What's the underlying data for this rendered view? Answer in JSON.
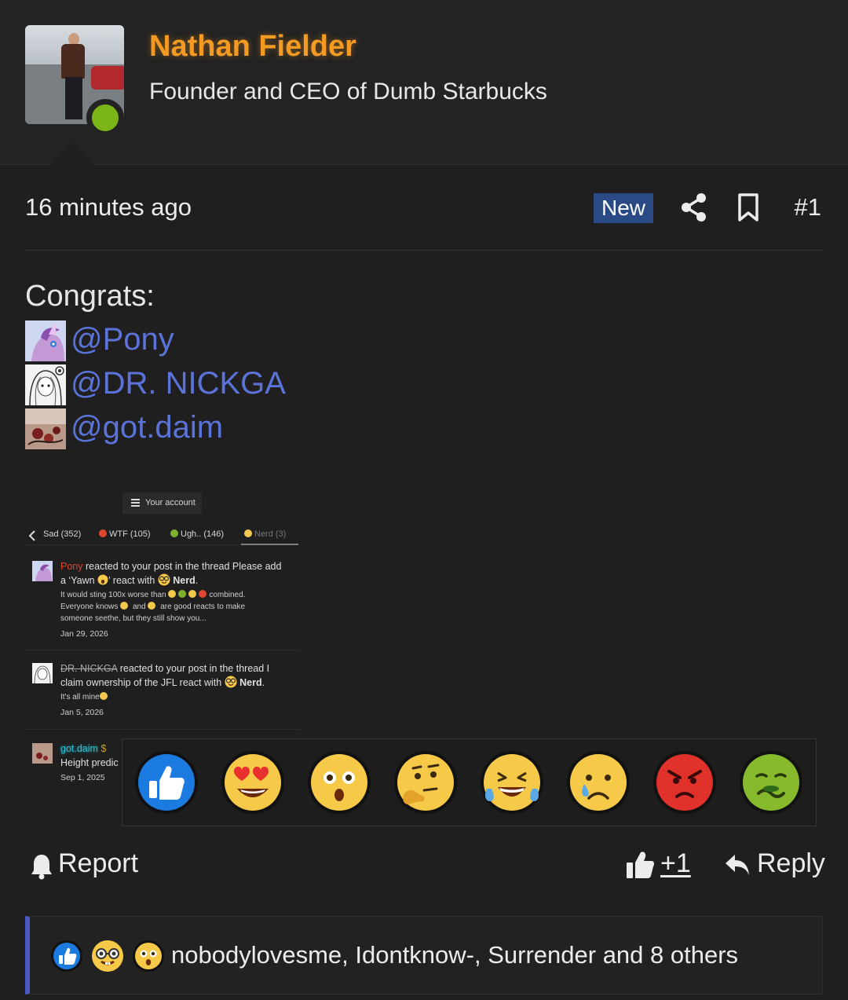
{
  "colors": {
    "username": "#f39a22",
    "mention_link": "#5b73d9",
    "badge_new_bg": "#2a4a86",
    "online_status": "#7cb518",
    "quote_accent": "#4b59c2",
    "background": "#1f1f1f"
  },
  "user": {
    "name": "Nathan Fielder",
    "title": "Founder and CEO of Dumb Starbucks",
    "status": "online"
  },
  "post": {
    "timestamp": "16 minutes ago",
    "badge": "New",
    "number": "#1",
    "congrats": "Congrats:",
    "mentions": [
      "@Pony",
      "@DR. NICKGA",
      "@got.daim"
    ]
  },
  "screenshot": {
    "account_button": "Your account",
    "tabs": [
      {
        "label": "Sad (352)"
      },
      {
        "label": "WTF (105)"
      },
      {
        "label": "Ugh.. (146)"
      },
      {
        "label": "Nerd (3)"
      }
    ],
    "notifications": [
      {
        "user": "Pony",
        "action": " reacted to your post in the thread Please add a ‘Yawn ",
        "action_mid": "’ react with ",
        "react": "Nerd",
        "end": ".",
        "excerpt_1": "It would sting 100x worse than",
        "excerpt_1b": "combined.",
        "excerpt_2": "Everyone knows",
        "excerpt_2b": "and",
        "excerpt_2c": "are good reacts to make",
        "excerpt_3": "someone seethe, but they still show you...",
        "date": "Jan 29, 2026"
      },
      {
        "user": "DR. NICKGA",
        "action": " reacted to your post in the thread I claim ownership of the JFL react with ",
        "react": "Nerd",
        "end": ".",
        "excerpt_1": "It's all mine",
        "date": "Jan 5, 2026"
      },
      {
        "user": "got.daim",
        "action_partial": "Height predic",
        "date": "Sep 1, 2025"
      }
    ]
  },
  "reaction_picker": [
    "like-icon",
    "heart-eyes-icon",
    "astonished-icon",
    "thinking-icon",
    "laughing-crying-icon",
    "sad-tear-icon",
    "angry-icon",
    "nauseated-icon"
  ],
  "actions": {
    "report": "Report",
    "like": "+1",
    "reply": "Reply"
  },
  "reactions_summary": {
    "icons": [
      "like-icon",
      "nerd-icon",
      "astonished-icon"
    ],
    "text": "nobodylovesme, Idontknow-, Surrender and 8 others"
  }
}
